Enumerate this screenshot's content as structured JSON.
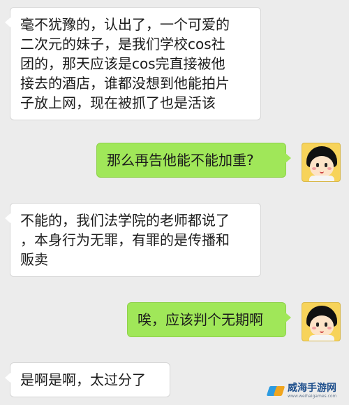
{
  "messages": [
    {
      "side": "in",
      "text": "毫不犹豫的，认出了，一个可爱的\n二次元的妹子，是我们学校cos社\n团的，那天应该是cos完直接被他\n接去的酒店，谁都没想到他能拍片\n子放上网，现在被抓了也是活该"
    },
    {
      "side": "out",
      "text": "那么再告他能不能加重?"
    },
    {
      "side": "in",
      "text": "不能的，我们法学院的老师都说了\n，本身行为无罪，有罪的是传播和\n贩卖"
    },
    {
      "side": "out",
      "text": "唉，应该判个无期啊"
    },
    {
      "side": "in",
      "text": "是啊是啊，太过分了"
    }
  ],
  "avatar": {
    "icon": "cartoon-girl-avatar-icon",
    "bg_color": "#f7d35a"
  },
  "colors": {
    "background": "#ececec",
    "incoming": "#ffffff",
    "outgoing": "#a0e759"
  },
  "watermark": {
    "title": "威海手游网",
    "url": "www.weihaigames.com"
  }
}
